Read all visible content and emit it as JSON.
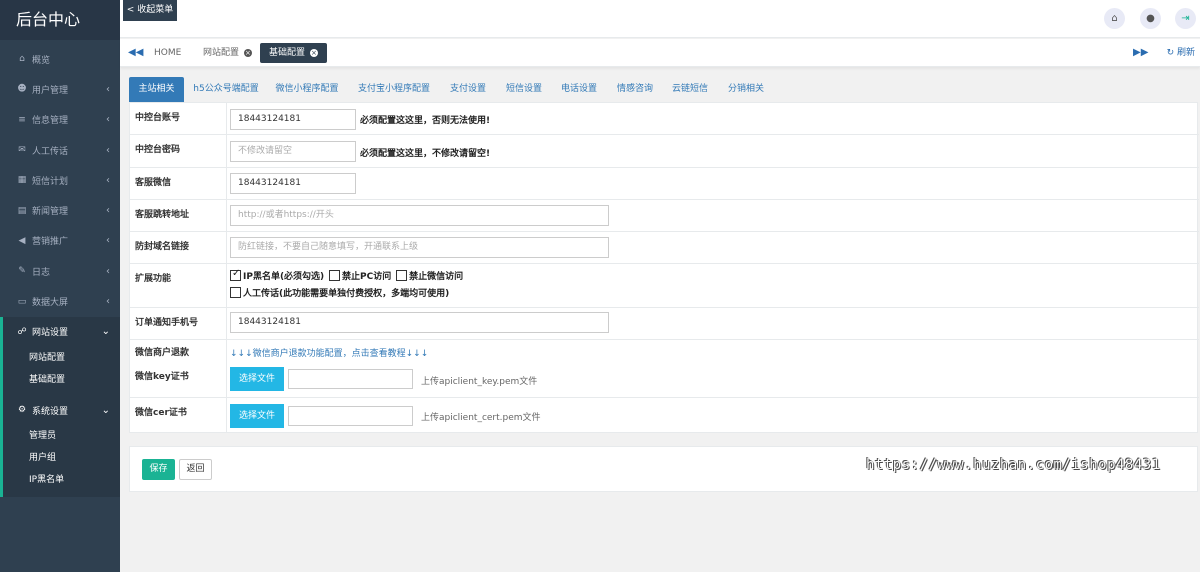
{
  "sidebar": {
    "brand": "后台中心",
    "items": [
      {
        "icon": "home-icon",
        "label": "概览",
        "arrow": ""
      },
      {
        "icon": "users-icon",
        "label": "用户管理",
        "arrow": "‹"
      },
      {
        "icon": "list-icon",
        "label": "信息管理",
        "arrow": "‹"
      },
      {
        "icon": "send-icon",
        "label": "人工传话",
        "arrow": "‹"
      },
      {
        "icon": "calendar-icon",
        "label": "短信计划",
        "arrow": "‹"
      },
      {
        "icon": "news-icon",
        "label": "新闻管理",
        "arrow": "‹"
      },
      {
        "icon": "bullhorn-icon",
        "label": "营销推广",
        "arrow": "‹"
      },
      {
        "icon": "edit-icon",
        "label": "日志",
        "arrow": "‹"
      },
      {
        "icon": "monitor-icon",
        "label": "数据大屏",
        "arrow": "‹"
      }
    ],
    "site_settings": {
      "label": "网站设置",
      "arrow": "⌄",
      "children": [
        "网站配置",
        "基础配置"
      ]
    },
    "system_settings": {
      "label": "系统设置",
      "arrow": "⌄",
      "children": [
        "管理员",
        "用户组",
        "IP黑名单"
      ]
    }
  },
  "topbar": {
    "collapse_label": "< 收起菜单"
  },
  "tabbar": {
    "tabs": [
      {
        "label": "HOME",
        "closable": false
      },
      {
        "label": "网站配置",
        "closable": true
      },
      {
        "label": "基础配置",
        "closable": true,
        "active": true
      }
    ],
    "refresh_label": "刷新"
  },
  "subtabs": [
    "主站相关",
    "h5公众号端配置",
    "微信小程序配置",
    "支付宝小程序配置",
    "支付设置",
    "短信设置",
    "电话设置",
    "情感咨询",
    "云链短信",
    "分销相关"
  ],
  "form": {
    "account": {
      "label": "中控台账号",
      "value": "18443124181",
      "hint": "必须配置这这里，否则无法使用!"
    },
    "password": {
      "label": "中控台密码",
      "placeholder": "不修改请留空",
      "hint": "必须配置这这里，不修改请留空!"
    },
    "wechat": {
      "label": "客服微信",
      "value": "18443124181"
    },
    "redirect": {
      "label": "客服跳转地址",
      "placeholder": "http://或者https://开头"
    },
    "anti_block": {
      "label": "防封域名链接",
      "placeholder": "防红链接，不要自己随意填写，开通联系上级"
    },
    "extensions": {
      "label": "扩展功能",
      "options": [
        {
          "label": "IP黑名单(必须勾选)",
          "checked": true
        },
        {
          "label": "禁止PC访问",
          "checked": false
        },
        {
          "label": "禁止微信访问",
          "checked": false
        },
        {
          "label": "人工传话(此功能需要单独付费授权，多端均可使用)",
          "checked": false
        }
      ]
    },
    "order_phone": {
      "label": "订单通知手机号",
      "value": "18443124181"
    },
    "refund": {
      "label": "微信商户退款",
      "link": "↓↓↓微信商户退款功能配置，点击查看教程↓↓↓"
    },
    "key_cert": {
      "label": "微信key证书",
      "button": "选择文件",
      "hint": "上传apiclient_key.pem文件"
    },
    "cer_cert": {
      "label": "微信cer证书",
      "button": "选择文件",
      "hint": "上传apiclient_cert.pem文件"
    }
  },
  "actions": {
    "save": "保存",
    "back": "返回"
  },
  "watermark": "https://www.huzhan.com/ishop48431",
  "colors": {
    "sidebar_bg": "#2f4050",
    "accent_green": "#1ab394",
    "accent_blue": "#337ab7",
    "file_btn": "#23b7e5"
  }
}
